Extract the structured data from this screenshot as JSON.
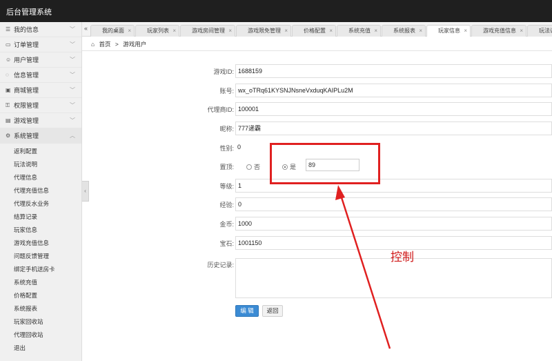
{
  "app_title": "后台管理系统",
  "sidebar": {
    "groups": [
      {
        "label": "我的信息",
        "icon": "list-icon"
      },
      {
        "label": "订单管理",
        "icon": "card-icon"
      },
      {
        "label": "用户管理",
        "icon": "user-icon"
      },
      {
        "label": "信息管理",
        "icon": "chat-icon"
      },
      {
        "label": "商城管理",
        "icon": "store-icon"
      },
      {
        "label": "权限管理",
        "icon": "key-icon"
      },
      {
        "label": "游戏管理",
        "icon": "game-icon"
      }
    ],
    "expanded": {
      "label": "系统管理",
      "icon": "gear-icon"
    },
    "sub_items": [
      "返利配置",
      "玩法说明",
      "代理信息",
      "代理充值信息",
      "代理反水业务",
      "结算记录",
      "玩家信息",
      "游戏充值信息",
      "问题反馈管理",
      "绑定手机送房卡",
      "系统充值",
      "价格配置",
      "系统报表",
      "玩家回收站",
      "代理回收站",
      "退出"
    ]
  },
  "tabs": [
    {
      "label": "我的桌面",
      "active": false
    },
    {
      "label": "玩家列表",
      "active": false
    },
    {
      "label": "游戏房间管理",
      "active": false
    },
    {
      "label": "游戏限免管理",
      "active": false
    },
    {
      "label": "价格配置",
      "active": false
    },
    {
      "label": "系统充值",
      "active": false
    },
    {
      "label": "系统报表",
      "active": false
    },
    {
      "label": "玩家信息",
      "active": true
    },
    {
      "label": "游戏充值信息",
      "active": false
    },
    {
      "label": "玩法说明",
      "active": false
    }
  ],
  "breadcrumb": {
    "home": "首页",
    "sep": ">",
    "current": "游戏用户"
  },
  "form": {
    "game_id_label": "游戏ID:",
    "game_id": "1688159",
    "account_label": "账号:",
    "account": "wx_oTRq61KYSNJNsneVxduqKAIPLu2M",
    "agent_id_label": "代理商ID:",
    "agent_id": "100001",
    "nickname_label": "昵称:",
    "nickname": "777递霸",
    "gender_label": "性别:",
    "gender": "0",
    "top_label": "置顶:",
    "top_no": "否",
    "top_yes": "是",
    "top_value": "89",
    "level_label": "等级:",
    "level": "1",
    "exp_label": "经验:",
    "exp": "0",
    "gold_label": "金币:",
    "gold": "1000",
    "gem_label": "宝石:",
    "gem": "1001150",
    "history_label": "历史记录:",
    "edit_button": "编 辑",
    "back_button": "返回"
  },
  "annotation": {
    "text": "控制",
    "color": "#e02020"
  }
}
